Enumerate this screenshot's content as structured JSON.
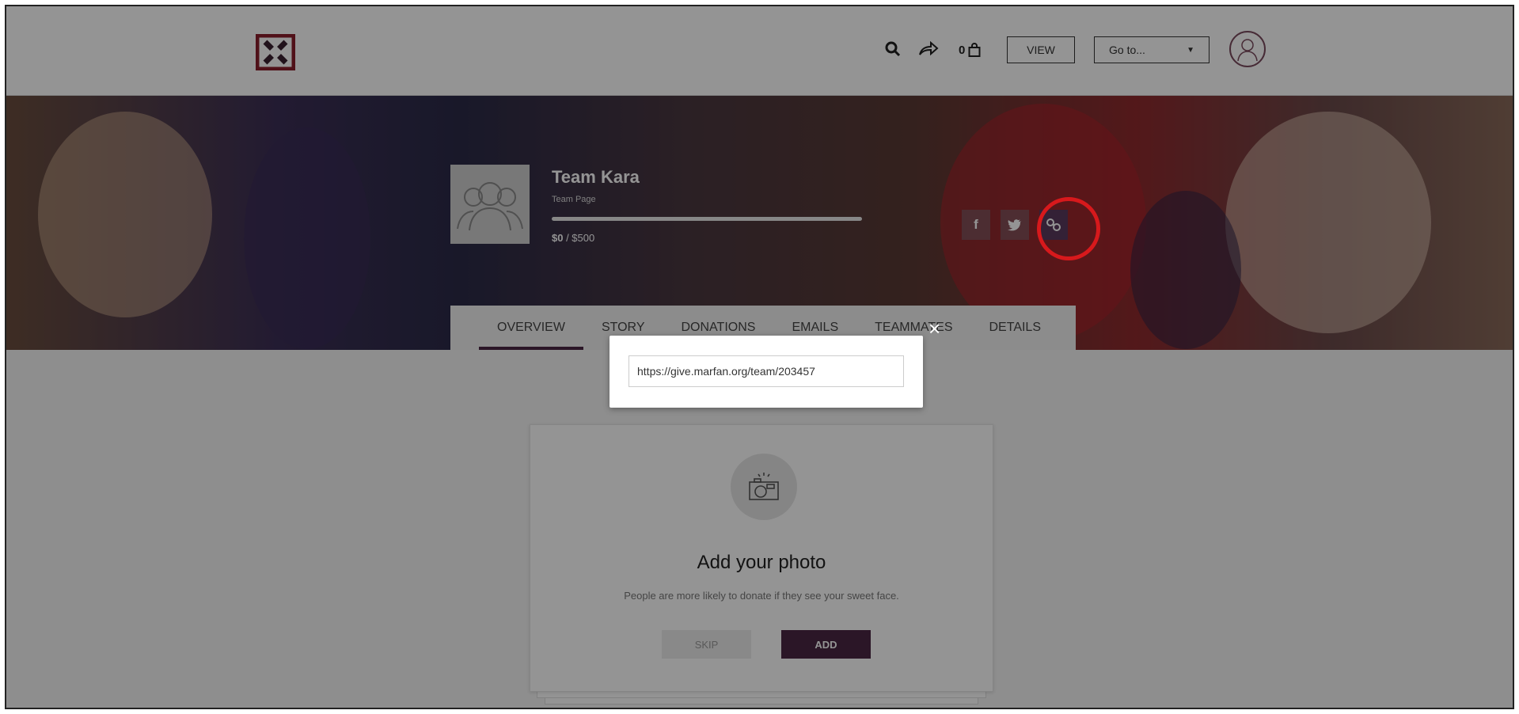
{
  "header": {
    "cart_count": "0",
    "view_label": "VIEW",
    "goto_label": "Go to...",
    "icons": [
      "logo",
      "search-icon",
      "share-icon",
      "bag-icon",
      "caret-down-icon",
      "avatar-icon"
    ]
  },
  "team": {
    "name": "Team Kara",
    "subtitle": "Team Page",
    "amount_raised": "$0",
    "goal_label": " / $500",
    "progress_fraction": 0
  },
  "social": {
    "facebook": "f",
    "twitter": "t",
    "link": "link"
  },
  "tabs": [
    {
      "label": "OVERVIEW",
      "active": true
    },
    {
      "label": "STORY",
      "active": false
    },
    {
      "label": "DONATIONS",
      "active": false
    },
    {
      "label": "EMAILS",
      "active": false
    },
    {
      "label": "TEAMMATES",
      "active": false
    },
    {
      "label": "DETAILS",
      "active": false
    }
  ],
  "modal": {
    "url": "https://give.marfan.org/team/203457",
    "close_symbol": "×"
  },
  "card": {
    "title": "Add your photo",
    "description": "People are more likely to donate if they see your sweet face.",
    "skip_label": "SKIP",
    "add_label": "ADD"
  },
  "colors": {
    "brand": "#4b2744",
    "highlight": "#d7191c"
  }
}
